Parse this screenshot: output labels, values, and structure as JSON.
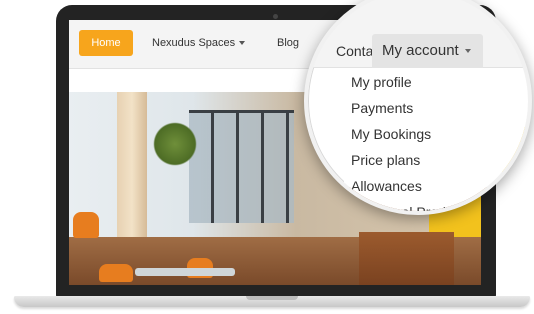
{
  "navbar": {
    "home_label": "Home",
    "spaces_label": "Nexudus Spaces",
    "blog_label": "Blog",
    "contact_label": "Conta"
  },
  "account_menu": {
    "trigger_label": "My account",
    "items": [
      {
        "label": "My profile"
      },
      {
        "label": "Payments"
      },
      {
        "label": "My Bookings"
      },
      {
        "label": "Price plans"
      },
      {
        "label": "Allowances"
      },
      {
        "label": "Additional Products"
      }
    ]
  },
  "colors": {
    "accent": "#f7a51c",
    "navbar_bg": "#f4f4f4",
    "laptop_frame": "#232323"
  },
  "icons": {
    "dropdown": "chevron-down-icon",
    "camera": "camera-icon"
  }
}
